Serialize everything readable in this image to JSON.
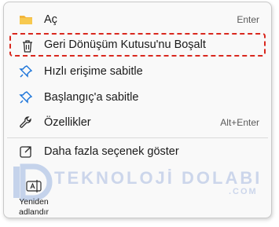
{
  "menu": {
    "items": [
      {
        "label": "Aç",
        "shortcut": "Enter",
        "icon": "folder-icon"
      },
      {
        "label": "Geri Dönüşüm Kutusu'nu Boşalt",
        "shortcut": "",
        "icon": "trash-icon"
      },
      {
        "label": "Hızlı erişime sabitle",
        "shortcut": "",
        "icon": "pin-icon"
      },
      {
        "label": "Başlangıç'a sabitle",
        "shortcut": "",
        "icon": "pin-icon"
      },
      {
        "label": "Özellikler",
        "shortcut": "Alt+Enter",
        "icon": "wrench-icon"
      },
      {
        "label": "Daha fazla seçenek göster",
        "shortcut": "",
        "icon": "external-link-icon"
      }
    ],
    "bottom_action": {
      "label_line1": "Yeniden",
      "label_line2": "adlandır",
      "icon": "rename-icon"
    }
  },
  "watermark": {
    "main": "TEKNOLOJİ DOLABI",
    "sub": ".COM"
  },
  "colors": {
    "accent": "#1a73d9",
    "highlight_border": "#d9281e",
    "folder": "#f2b53b"
  }
}
